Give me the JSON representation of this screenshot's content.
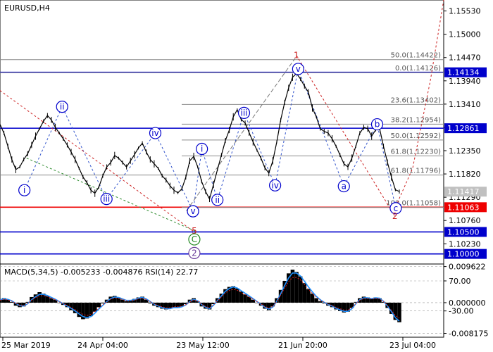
{
  "symbol_title": "EURUSD,H4",
  "price_axis": {
    "ticks": [
      "1.15530",
      "1.15000",
      "1.14470",
      "1.13940",
      "1.13410",
      "1.12880",
      "1.12350",
      "1.11820",
      "1.11290",
      "1.10760",
      "1.10230"
    ],
    "tick_values": [
      1.1553,
      1.15,
      1.1447,
      1.1394,
      1.1341,
      1.1288,
      1.1235,
      1.1182,
      1.1129,
      1.1076,
      1.1023
    ],
    "ylim": [
      1.0977,
      1.1578
    ]
  },
  "date_axis": {
    "ticks": [
      "25 Mar 2019",
      "24 Apr 04:00",
      "23 May 12:00",
      "21 Jun 20:00",
      "23 Jul 04:00"
    ],
    "positions": [
      0,
      0.25,
      0.5,
      0.75,
      1.0
    ]
  },
  "price_labels": [
    {
      "text": "1.14134",
      "value": 1.14134,
      "color": "#0000cc",
      "fg": "#ffffff",
      "line": true
    },
    {
      "text": "1.12861",
      "value": 1.12861,
      "color": "#0000cc",
      "fg": "#ffffff",
      "line": true
    },
    {
      "text": "1.11417",
      "value": 1.11417,
      "color": "#c0c0c0",
      "fg": "#ffffff",
      "line": false
    },
    {
      "text": "1.11063",
      "value": 1.11063,
      "color": "#ee0000",
      "fg": "#ffffff",
      "line": true
    },
    {
      "text": "1.10500",
      "value": 1.105,
      "color": "#0000cc",
      "fg": "#ffffff",
      "line": true
    },
    {
      "text": "1.10000",
      "value": 1.1,
      "color": "#0000cc",
      "fg": "#ffffff",
      "line": true
    }
  ],
  "fib_levels": [
    {
      "text": "50.0(1.14422)",
      "value": 1.14422
    },
    {
      "text": "0.0(1.14126)",
      "value": 1.14126
    },
    {
      "text": "23.6(1.13402)",
      "value": 1.13402
    },
    {
      "text": "38.2(1.12954)",
      "value": 1.12954
    },
    {
      "text": "50.0(1.12592)",
      "value": 1.12592
    },
    {
      "text": "61.8(1.12230)",
      "value": 1.1223
    },
    {
      "text": "61.8(1.11796)",
      "value": 1.11796
    },
    {
      "text": "100.0(1.11058)",
      "value": 1.11058
    }
  ],
  "wave_labels": [
    {
      "text": "ii",
      "t": 0.14,
      "value": 1.1335,
      "circle": true,
      "color": "#0000cc"
    },
    {
      "text": "i",
      "t": 0.055,
      "value": 1.1145,
      "circle": true,
      "color": "#0000cc"
    },
    {
      "text": "iii",
      "t": 0.24,
      "value": 1.1125,
      "circle": true,
      "color": "#0000cc"
    },
    {
      "text": "iv",
      "t": 0.35,
      "value": 1.1275,
      "circle": true,
      "color": "#0000cc"
    },
    {
      "text": "v",
      "t": 0.435,
      "value": 1.1097,
      "circle": true,
      "color": "#0000cc"
    },
    {
      "text": "i",
      "t": 0.455,
      "value": 1.1239,
      "circle": true,
      "color": "#0000cc"
    },
    {
      "text": "ii",
      "t": 0.49,
      "value": 1.1123,
      "circle": true,
      "color": "#0000cc"
    },
    {
      "text": "iii",
      "t": 0.55,
      "value": 1.1321,
      "circle": true,
      "color": "#0000cc"
    },
    {
      "text": "iv",
      "t": 0.62,
      "value": 1.1156,
      "circle": true,
      "color": "#0000cc"
    },
    {
      "text": "v",
      "t": 0.672,
      "value": 1.1421,
      "circle": true,
      "color": "#0000cc"
    },
    {
      "text": "a",
      "t": 0.775,
      "value": 1.1154,
      "circle": true,
      "color": "#0000cc"
    },
    {
      "text": "b",
      "t": 0.85,
      "value": 1.1295,
      "circle": true,
      "color": "#0000cc"
    },
    {
      "text": "c",
      "t": 0.892,
      "value": 1.1104,
      "circle": true,
      "color": "#0000cc"
    },
    {
      "text": "1",
      "t": 0.668,
      "value": 1.1452,
      "circle": false,
      "color": "#cc2222"
    },
    {
      "text": "2",
      "t": 0.89,
      "value": 1.1086,
      "circle": false,
      "color": "#cc2222"
    },
    {
      "text": "5",
      "t": 0.438,
      "value": 1.1052,
      "circle": false,
      "color": "#cc2222"
    },
    {
      "text": "C",
      "t": 0.438,
      "value": 1.1033,
      "circle": true,
      "color": "#228822"
    },
    {
      "text": "2",
      "t": 0.438,
      "value": 1.1002,
      "circle": true,
      "color": "#6a3d9a"
    }
  ],
  "chart_data": {
    "type": "line",
    "title": "EURUSD,H4",
    "x_start_label": "25 Mar 2019",
    "x_end_label": "23 Jul 04:00",
    "x_span": [
      0,
      0.9
    ],
    "price_series": {
      "name": "EURUSD",
      "values": [
        1.1295,
        1.1275,
        1.1245,
        1.1215,
        1.1192,
        1.1198,
        1.1215,
        1.1228,
        1.1248,
        1.1268,
        1.1285,
        1.1302,
        1.1315,
        1.1305,
        1.1288,
        1.1275,
        1.1262,
        1.1248,
        1.1232,
        1.1215,
        1.1195,
        1.1175,
        1.1162,
        1.1145,
        1.1138,
        1.1152,
        1.1178,
        1.1198,
        1.1208,
        1.1224,
        1.1218,
        1.1208,
        1.1198,
        1.1212,
        1.1226,
        1.1241,
        1.1252,
        1.1232,
        1.1215,
        1.1205,
        1.1195,
        1.1178,
        1.1168,
        1.1155,
        1.1145,
        1.1139,
        1.1148,
        1.1175,
        1.1212,
        1.1222,
        1.1198,
        1.1165,
        1.1142,
        1.1125,
        1.1158,
        1.1192,
        1.1225,
        1.1258,
        1.1282,
        1.1312,
        1.1328,
        1.1306,
        1.1298,
        1.1276,
        1.1255,
        1.1236,
        1.1218,
        1.1196,
        1.1184,
        1.1212,
        1.1255,
        1.1305,
        1.1345,
        1.1378,
        1.1402,
        1.1411,
        1.1398,
        1.1382,
        1.1368,
        1.1332,
        1.1312,
        1.1285,
        1.1279,
        1.1275,
        1.1262,
        1.1245,
        1.1225,
        1.1205,
        1.1198,
        1.1218,
        1.1245,
        1.1275,
        1.1288,
        1.1285,
        1.1268,
        1.1282,
        1.1286,
        1.1245,
        1.1208,
        1.1175,
        1.1146,
        1.1142
      ]
    },
    "projection": {
      "name": "forecast",
      "points": [
        [
          0.892,
          1.1108
        ],
        [
          0.93,
          1.1195
        ],
        [
          0.97,
          1.1395
        ],
        [
          1.0,
          1.1578
        ]
      ]
    },
    "indicator": {
      "label": "MACD(5,34,5) -0.005233 -0.004876 RSI(14) 22.77",
      "ticks": [
        "0.009622",
        "70.00",
        "0.000000",
        "-30.00",
        "-0.008175"
      ],
      "tick_values": [
        0.009622,
        0.0058,
        0.0,
        -0.0022,
        -0.008175
      ],
      "ylim": [
        -0.0092,
        0.0103
      ],
      "histogram": [
        0.001,
        0.0012,
        0.0008,
        0.0002,
        -0.0008,
        -0.0012,
        -0.001,
        0.0002,
        0.0015,
        0.0022,
        0.0028,
        0.0024,
        0.0018,
        0.0012,
        0.0008,
        0.0,
        -0.0006,
        -0.0012,
        -0.002,
        -0.0028,
        -0.0038,
        -0.0044,
        -0.0042,
        -0.0036,
        -0.0024,
        -0.0012,
        -0.0002,
        0.0008,
        0.0016,
        0.0018,
        0.0014,
        0.0008,
        0.0004,
        0.0006,
        0.001,
        0.0014,
        0.0016,
        0.0008,
        -0.0002,
        -0.0008,
        -0.0012,
        -0.0016,
        -0.0018,
        -0.0016,
        -0.0012,
        -0.0014,
        -0.001,
        -0.0004,
        0.0008,
        0.0012,
        0.0004,
        -0.001,
        -0.0016,
        -0.0018,
        -0.0004,
        0.0012,
        0.0024,
        0.0036,
        0.0042,
        0.0044,
        0.0038,
        0.003,
        0.0022,
        0.0016,
        0.0008,
        0.0,
        -0.0008,
        -0.0016,
        -0.002,
        -0.001,
        0.0012,
        0.0034,
        0.0058,
        0.0078,
        0.0088,
        0.0082,
        0.007,
        0.0052,
        0.0036,
        0.0024,
        0.0012,
        0.0004,
        -0.0002,
        -0.0008,
        -0.0012,
        -0.0018,
        -0.0022,
        -0.0026,
        -0.0024,
        -0.0014,
        0.0002,
        0.0012,
        0.0016,
        0.0014,
        0.001,
        0.0014,
        0.0012,
        0.0002,
        -0.0014,
        -0.003,
        -0.0046,
        -0.0052
      ],
      "signal": [
        0.0008,
        0.001,
        0.0009,
        0.0005,
        -0.0002,
        -0.0008,
        -0.0009,
        -0.0003,
        0.0008,
        0.0016,
        0.0022,
        0.0022,
        0.0019,
        0.0014,
        0.0009,
        0.0003,
        -0.0003,
        -0.0009,
        -0.0015,
        -0.0022,
        -0.003,
        -0.0037,
        -0.004,
        -0.0037,
        -0.0028,
        -0.0017,
        -0.0007,
        0.0003,
        0.0011,
        0.0015,
        0.0014,
        0.001,
        0.0006,
        0.0006,
        0.0008,
        0.0012,
        0.0014,
        0.001,
        0.0003,
        -0.0004,
        -0.0009,
        -0.0013,
        -0.0016,
        -0.0016,
        -0.0013,
        -0.0013,
        -0.0011,
        -0.0006,
        0.0003,
        0.0009,
        0.0005,
        -0.0005,
        -0.0012,
        -0.0016,
        -0.0007,
        0.0006,
        0.0018,
        0.003,
        0.0038,
        0.0042,
        0.0039,
        0.0032,
        0.0025,
        0.0018,
        0.0011,
        0.0003,
        -0.0004,
        -0.0012,
        -0.0017,
        -0.0012,
        0.0004,
        0.0024,
        0.0046,
        0.0066,
        0.0079,
        0.0079,
        0.0071,
        0.0057,
        0.0042,
        0.0029,
        0.0017,
        0.0008,
        0.0001,
        -0.0005,
        -0.0009,
        -0.0015,
        -0.0019,
        -0.0023,
        -0.0023,
        -0.0016,
        -0.0003,
        0.0008,
        0.0013,
        0.0013,
        0.0011,
        0.0013,
        0.0012,
        0.0004,
        -0.0009,
        -0.0024,
        -0.004,
        -0.0049
      ]
    }
  }
}
